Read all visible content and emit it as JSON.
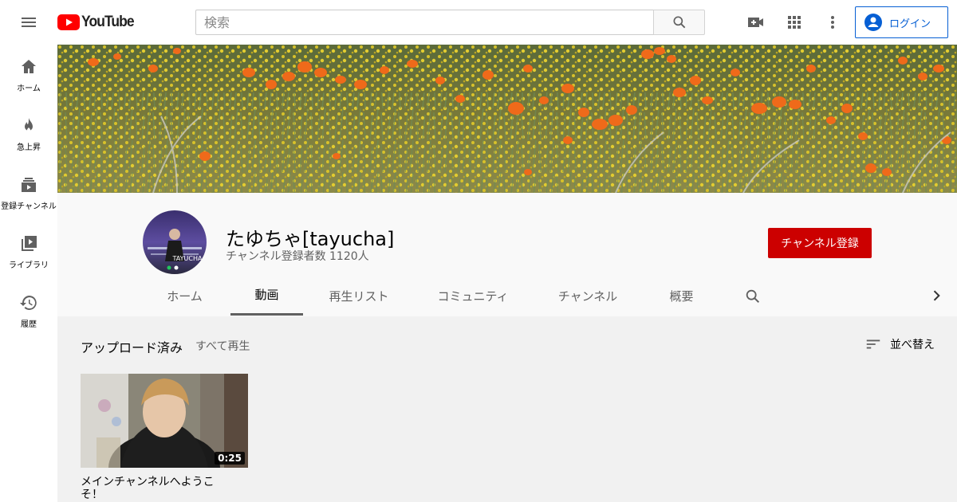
{
  "masthead": {
    "logo_text": "YouTube",
    "search_placeholder": "検索",
    "login_label": "ログイン"
  },
  "sidebar": {
    "items": [
      {
        "label": "ホーム",
        "icon": "home-icon"
      },
      {
        "label": "急上昇",
        "icon": "fire-icon"
      },
      {
        "label": "登録チャンネル",
        "icon": "subscriptions-icon"
      },
      {
        "label": "ライブラリ",
        "icon": "library-icon"
      },
      {
        "label": "履歴",
        "icon": "history-icon"
      }
    ]
  },
  "channel": {
    "name": "たゆちゃ[tayucha]",
    "subscribers": "チャンネル登録者数 1120人",
    "subscribe_label": "チャンネル登録",
    "avatar_text": "TAYUCHA"
  },
  "tabs": [
    {
      "label": "ホーム",
      "active": false
    },
    {
      "label": "動画",
      "active": true
    },
    {
      "label": "再生リスト",
      "active": false
    },
    {
      "label": "コミュニティ",
      "active": false
    },
    {
      "label": "チャンネル",
      "active": false
    },
    {
      "label": "概要",
      "active": false
    }
  ],
  "content": {
    "section_title": "アップロード済み",
    "play_all": "すべて再生",
    "sort_label": "並べ替え",
    "videos": [
      {
        "title": "メインチャンネルへようこそ！",
        "duration": "0:25"
      }
    ]
  },
  "colors": {
    "brand_red": "#ff0000",
    "subscribe_red": "#cc0000",
    "link_blue": "#065fd4"
  }
}
